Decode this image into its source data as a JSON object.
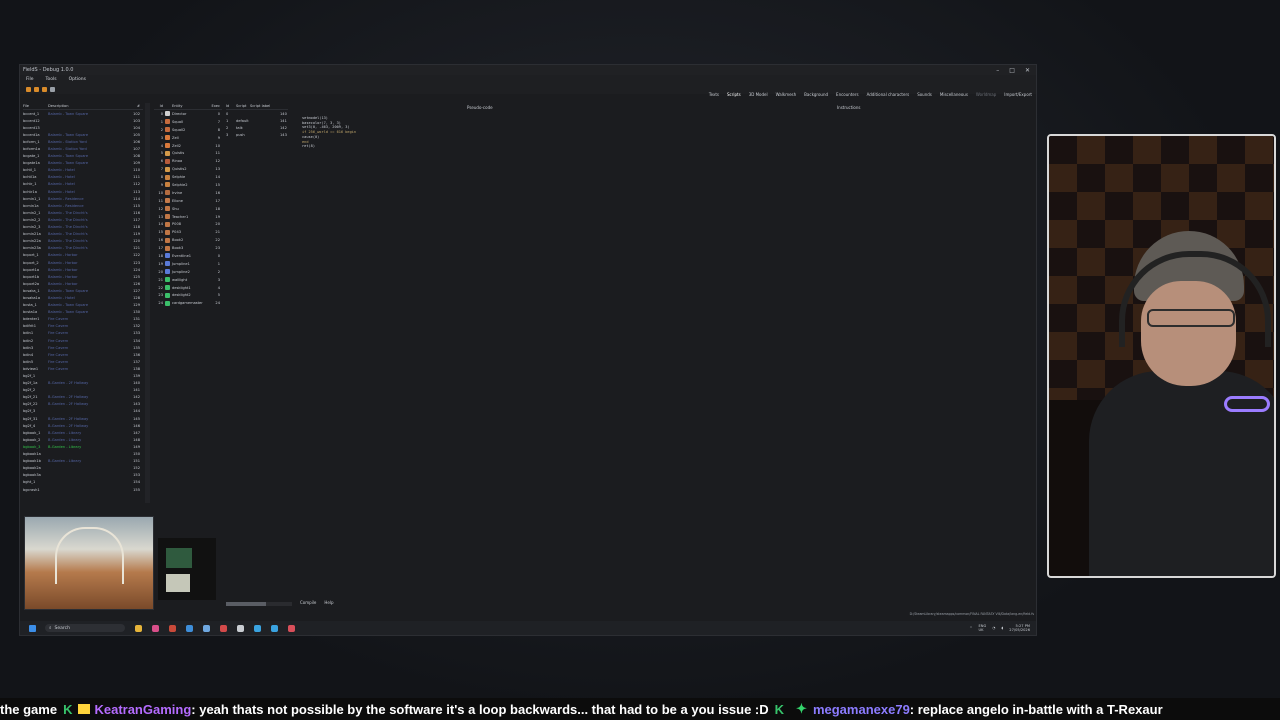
{
  "window": {
    "title": "FieldS - Debug 1.0.0",
    "menu": [
      "File",
      "Tools",
      "Options"
    ],
    "tabs": [
      "Texts",
      "Scripts",
      "3D Model",
      "Walkmesh",
      "Background",
      "Encounters",
      "Additional characters",
      "Sounds",
      "Miscellaneous",
      "Worldmap",
      "Import/Export"
    ],
    "active_tab": "Scripts",
    "pseudo_code_label": "Pseudo-code",
    "instructions_label": "Instructions",
    "bottom_links": [
      "Compile",
      "Help"
    ],
    "path": "D:/SteamLibrary/steamapps/common/FINAL FANTASY VIII/Data/lang-en/field.fs"
  },
  "filelist": {
    "headers": [
      "File",
      "Description",
      "#"
    ],
    "rows": [
      {
        "name": "bccent_1",
        "desc": "Balamb - Town Square",
        "num": "102"
      },
      {
        "name": "bccent12",
        "desc": "",
        "num": "103"
      },
      {
        "name": "bccent13",
        "desc": "",
        "num": "104"
      },
      {
        "name": "bccent1a",
        "desc": "Balamb - Town Square",
        "num": "105"
      },
      {
        "name": "bcform_1",
        "desc": "Balamb - Station Yard",
        "num": "106"
      },
      {
        "name": "bcform1a",
        "desc": "Balamb - Station Yard",
        "num": "107"
      },
      {
        "name": "bcgate_1",
        "desc": "Balamb - Town Square",
        "num": "108"
      },
      {
        "name": "bcgate1a",
        "desc": "Balamb - Town Square",
        "num": "109"
      },
      {
        "name": "bchtl_1",
        "desc": "Balamb - Hotel",
        "num": "110"
      },
      {
        "name": "bchtl1a",
        "desc": "Balamb - Hotel",
        "num": "111"
      },
      {
        "name": "bchtr_1",
        "desc": "Balamb - Hotel",
        "num": "112"
      },
      {
        "name": "bchtr1a",
        "desc": "Balamb - Hotel",
        "num": "113"
      },
      {
        "name": "bcmin1_1",
        "desc": "Balamb - Residence",
        "num": "114"
      },
      {
        "name": "bcmin1a",
        "desc": "Balamb - Residence",
        "num": "115"
      },
      {
        "name": "bcmin2_1",
        "desc": "Balamb - The Dincht's",
        "num": "116"
      },
      {
        "name": "bcmin2_2",
        "desc": "Balamb - The Dincht's",
        "num": "117"
      },
      {
        "name": "bcmin2_3",
        "desc": "Balamb - The Dincht's",
        "num": "118"
      },
      {
        "name": "bcmin21a",
        "desc": "Balamb - The Dincht's",
        "num": "119"
      },
      {
        "name": "bcmin22a",
        "desc": "Balamb - The Dincht's",
        "num": "120"
      },
      {
        "name": "bcmin23a",
        "desc": "Balamb - The Dincht's",
        "num": "121"
      },
      {
        "name": "bcport_1",
        "desc": "Balamb - Harbor",
        "num": "122"
      },
      {
        "name": "bcport_2",
        "desc": "Balamb - Harbor",
        "num": "123"
      },
      {
        "name": "bcport1a",
        "desc": "Balamb - Harbor",
        "num": "124"
      },
      {
        "name": "bcport1b",
        "desc": "Balamb - Harbor",
        "num": "125"
      },
      {
        "name": "bcport2a",
        "desc": "Balamb - Harbor",
        "num": "126"
      },
      {
        "name": "bcsaka_1",
        "desc": "Balamb - Town Square",
        "num": "127"
      },
      {
        "name": "bcsaka1a",
        "desc": "Balamb - Hotel",
        "num": "128"
      },
      {
        "name": "bcsta_1",
        "desc": "Balamb - Town Square",
        "num": "129"
      },
      {
        "name": "bcsta1a",
        "desc": "Balamb - Town Square",
        "num": "130"
      },
      {
        "name": "bdenter1",
        "desc": "Fire Cavern",
        "num": "131"
      },
      {
        "name": "bdifrit1",
        "desc": "Fire Cavern",
        "num": "132"
      },
      {
        "name": "bdin1",
        "desc": "Fire Cavern",
        "num": "133"
      },
      {
        "name": "bdin2",
        "desc": "Fire Cavern",
        "num": "134"
      },
      {
        "name": "bdin3",
        "desc": "Fire Cavern",
        "num": "135"
      },
      {
        "name": "bdin4",
        "desc": "Fire Cavern",
        "num": "136"
      },
      {
        "name": "bdin5",
        "desc": "Fire Cavern",
        "num": "137"
      },
      {
        "name": "bdview1",
        "desc": "Fire Cavern",
        "num": "138"
      },
      {
        "name": "bg2f_1",
        "desc": "",
        "num": "139"
      },
      {
        "name": "bg2f_1a",
        "desc": "B-Garden - 2F Hallway",
        "num": "140"
      },
      {
        "name": "bg2f_2",
        "desc": "",
        "num": "141"
      },
      {
        "name": "bg2f_21",
        "desc": "B-Garden - 2F Hallway",
        "num": "142"
      },
      {
        "name": "bg2f_22",
        "desc": "B-Garden - 2F Hallway",
        "num": "143"
      },
      {
        "name": "bg2f_3",
        "desc": "",
        "num": "144"
      },
      {
        "name": "bg2f_31",
        "desc": "B-Garden - 2F Hallway",
        "num": "145"
      },
      {
        "name": "bg2f_4",
        "desc": "B-Garden - 2F Hallway",
        "num": "146"
      },
      {
        "name": "bgbook_1",
        "desc": "B-Garden - Library",
        "num": "147"
      },
      {
        "name": "bgbook_2",
        "desc": "B-Garden - Library",
        "num": "148"
      },
      {
        "name": "bgbook_3",
        "desc": "B-Garden - Library",
        "num": "149",
        "selected": true
      },
      {
        "name": "bgbook1a",
        "desc": "",
        "num": "150"
      },
      {
        "name": "bgbook1b",
        "desc": "B-Garden - Library",
        "num": "151"
      },
      {
        "name": "bgbook2a",
        "desc": "",
        "num": "152"
      },
      {
        "name": "bgbook3a",
        "desc": "",
        "num": "153"
      },
      {
        "name": "bght_1",
        "desc": "",
        "num": "154"
      },
      {
        "name": "bgcrash1",
        "desc": "",
        "num": "155"
      }
    ]
  },
  "entities": {
    "headers": [
      "Id",
      "Entity",
      "Exec"
    ],
    "rows": [
      {
        "id": "0",
        "name": "Director",
        "exec": "0",
        "color": "#cfcfcf"
      },
      {
        "id": "1",
        "name": "Squall",
        "exec": "7",
        "color": "#c56b3d"
      },
      {
        "id": "2",
        "name": "Squall2",
        "exec": "8",
        "color": "#c56b3d"
      },
      {
        "id": "3",
        "name": "Zell",
        "exec": "9",
        "color": "#d9793b"
      },
      {
        "id": "4",
        "name": "Zell2",
        "exec": "10",
        "color": "#d9793b"
      },
      {
        "id": "5",
        "name": "Quistis",
        "exec": "11",
        "color": "#d49a4a"
      },
      {
        "id": "6",
        "name": "Rinoa",
        "exec": "12",
        "color": "#b65a3a"
      },
      {
        "id": "7",
        "name": "Quistis2",
        "exec": "13",
        "color": "#d49a4a"
      },
      {
        "id": "8",
        "name": "Selphie",
        "exec": "14",
        "color": "#c8813f"
      },
      {
        "id": "9",
        "name": "Selphie2",
        "exec": "15",
        "color": "#c8813f"
      },
      {
        "id": "10",
        "name": "Irvine",
        "exec": "16",
        "color": "#b46c40"
      },
      {
        "id": "11",
        "name": "Ellone",
        "exec": "17",
        "color": "#c47a4a"
      },
      {
        "id": "12",
        "name": "Shu",
        "exec": "18",
        "color": "#c07645"
      },
      {
        "id": "13",
        "name": "Teacher1",
        "exec": "19",
        "color": "#c07645"
      },
      {
        "id": "14",
        "name": "P008",
        "exec": "20",
        "color": "#c07645"
      },
      {
        "id": "15",
        "name": "P043",
        "exec": "21",
        "color": "#c07645"
      },
      {
        "id": "16",
        "name": "Book2",
        "exec": "22",
        "color": "#c07645"
      },
      {
        "id": "17",
        "name": "Book3",
        "exec": "23",
        "color": "#c07645"
      },
      {
        "id": "18",
        "name": "Eventline1",
        "exec": "0",
        "color": "#5a7ad8"
      },
      {
        "id": "19",
        "name": "Jumpline1",
        "exec": "1",
        "color": "#5a7ad8"
      },
      {
        "id": "20",
        "name": "Jumpline2",
        "exec": "2",
        "color": "#5a7ad8"
      },
      {
        "id": "21",
        "name": "walllight",
        "exec": "3",
        "color": "#3bbf6a"
      },
      {
        "id": "22",
        "name": "desklight1",
        "exec": "4",
        "color": "#3bbf6a"
      },
      {
        "id": "23",
        "name": "desklight2",
        "exec": "5",
        "color": "#3bbf6a"
      },
      {
        "id": "24",
        "name": "cardgamemaster",
        "exec": "24",
        "color": "#3bbf6a"
      }
    ]
  },
  "scripts": {
    "headers": [
      "Id",
      "Script",
      "Script label"
    ],
    "rows": [
      {
        "id": "0",
        "label": "",
        "val": "140"
      },
      {
        "id": "1",
        "label": "default",
        "val": "141"
      },
      {
        "id": "2",
        "label": "talk",
        "val": "142"
      },
      {
        "id": "3",
        "label": "push",
        "val": "143"
      }
    ]
  },
  "code_lines": [
    "setmodel(13)",
    "basecolor(7, 3, 3)",
    "set3(0, -463, 2009, 3)",
    "if 256_world == 616 begin",
    "    cause(0)",
    "end",
    "ret(8)"
  ],
  "taskbar": {
    "search_placeholder": "Search",
    "lang_top": "ENG",
    "lang_bottom": "UK",
    "time": "5:27 PM",
    "date": "27/05/2026"
  },
  "ticker": {
    "lead": "the game",
    "user1": "KeatranGaming",
    "msg1": ": yeah thats not possible by the software it's a loop backwards... that had to be a you issue :D",
    "user2": "megamanexe79",
    "msg2": ": replace angelo in-battle with a T-Rexaur"
  },
  "colors": {
    "accent_green": "#37c36b",
    "user1": "#b56cff",
    "user2": "#8c7cff"
  }
}
